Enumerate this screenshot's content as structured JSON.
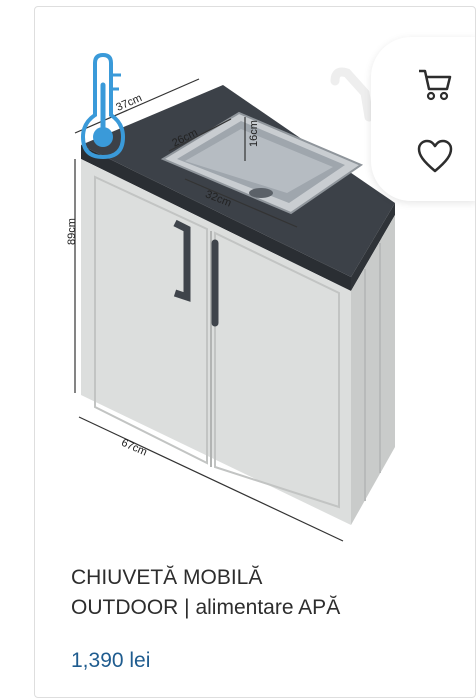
{
  "product": {
    "title_line1": "CHIUVETĂ MOBILĂ",
    "title_line2": "OUTDOOR | alimentare APĂ",
    "price": "1,390 lei"
  },
  "dimensions": {
    "depth": "37cm",
    "sink_width": "26cm",
    "sink_depth": "16cm",
    "sink_length": "32cm",
    "height": "89cm",
    "width": "67cm"
  },
  "icons": {
    "badge": "thermometer-icon",
    "cart": "cart-icon",
    "favorite": "heart-icon"
  },
  "colors": {
    "price": "#1f5c8f",
    "thermometer": "#3a9ad9",
    "countertop": "#3f444b",
    "cabinet": "#dcdedd"
  }
}
